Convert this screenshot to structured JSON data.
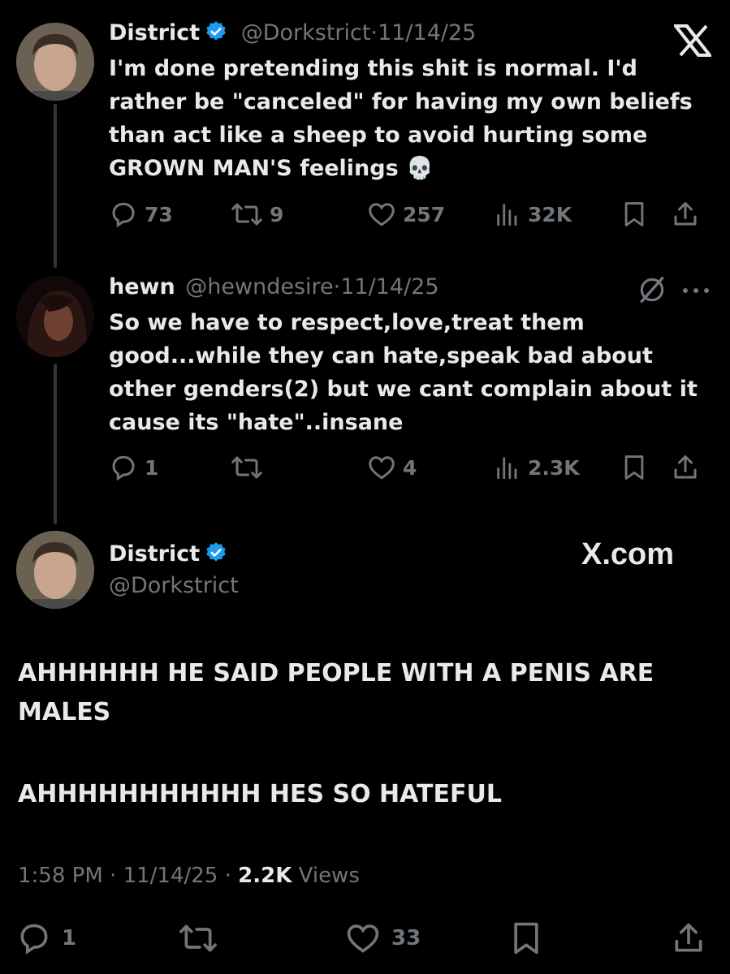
{
  "tweet1": {
    "display_name": "District",
    "handle": "@Dorkstrict",
    "date": "11/14/25",
    "text": "I'm done pretending this shit is normal. I'd rather be \"canceled\" for having my own beliefs than act like a sheep to avoid hurting some GROWN MAN'S feelings 💀",
    "replies": "73",
    "reposts": "9",
    "likes": "257",
    "views": "32K"
  },
  "tweet2": {
    "display_name": "hewn",
    "handle": "@hewndesire",
    "date": "11/14/25",
    "text": "So we have to respect,love,treat them good...while they can hate,speak bad about other genders(2) but we cant complain about it cause its \"hate\"..insane",
    "replies": "1",
    "reposts": "",
    "likes": "4",
    "views": "2.3K"
  },
  "tweet3": {
    "display_name": "District",
    "handle": "@Dorkstrict",
    "watermark": "X.com",
    "line1": "AHHHHHH HE SAID PEOPLE WITH A PENIS ARE",
    "line2": "MALES",
    "line3": "AHHHHHHHHHHH HES SO HATEFUL",
    "time": "1:58 PM",
    "date": "11/14/25",
    "views_count": "2.2K",
    "views_label": "Views",
    "replies": "1",
    "likes": "33"
  },
  "separator": "·",
  "colors": {
    "accent": "#1d9bf0",
    "muted": "#71767b",
    "text": "#e7e9ea",
    "bg": "#000000"
  },
  "icons": [
    "x-logo-icon",
    "verified-badge-icon",
    "reply-icon",
    "repost-icon",
    "like-icon",
    "views-icon",
    "bookmark-icon",
    "share-icon",
    "grok-icon",
    "more-icon"
  ]
}
